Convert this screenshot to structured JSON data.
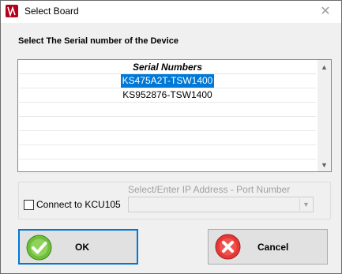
{
  "window": {
    "title": "Select Board"
  },
  "instruction": "Select The Serial number of the Device",
  "list": {
    "header": "Serial Numbers",
    "rows": [
      {
        "value": "KS475A2T-TSW1400",
        "selected": true
      },
      {
        "value": "KS952876-TSW1400",
        "selected": false
      },
      {
        "value": "",
        "selected": false
      },
      {
        "value": "",
        "selected": false
      },
      {
        "value": "",
        "selected": false
      },
      {
        "value": "",
        "selected": false
      },
      {
        "value": "",
        "selected": false
      }
    ]
  },
  "connection": {
    "checkbox_label": "Connect to KCU105",
    "ip_label": "Select/Enter IP Address - Port Number",
    "ip_value": ""
  },
  "buttons": {
    "ok": "OK",
    "cancel": "Cancel"
  },
  "colors": {
    "selection": "#0078d7",
    "ok_icon": "#6fbf3a",
    "cancel_icon": "#e53935"
  }
}
